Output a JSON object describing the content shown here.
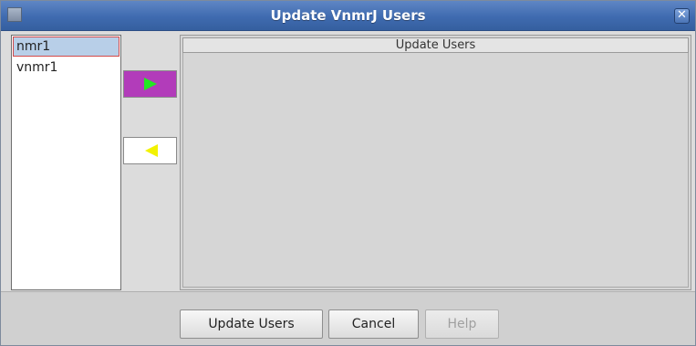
{
  "window": {
    "title": "Update VnmrJ Users"
  },
  "user_list": {
    "items": [
      {
        "label": "nmr1",
        "selected": true
      },
      {
        "label": "vnmr1",
        "selected": false
      }
    ]
  },
  "transfer": {
    "add_icon": "right-arrow-icon",
    "remove_icon": "left-arrow-icon",
    "add_color": "#b23cba",
    "arrow_green": "#22e822",
    "arrow_yellow": "#f2f200"
  },
  "panel": {
    "header": "Update Users"
  },
  "buttons": {
    "update_label": "Update Users",
    "cancel_label": "Cancel",
    "help_label": "Help"
  }
}
